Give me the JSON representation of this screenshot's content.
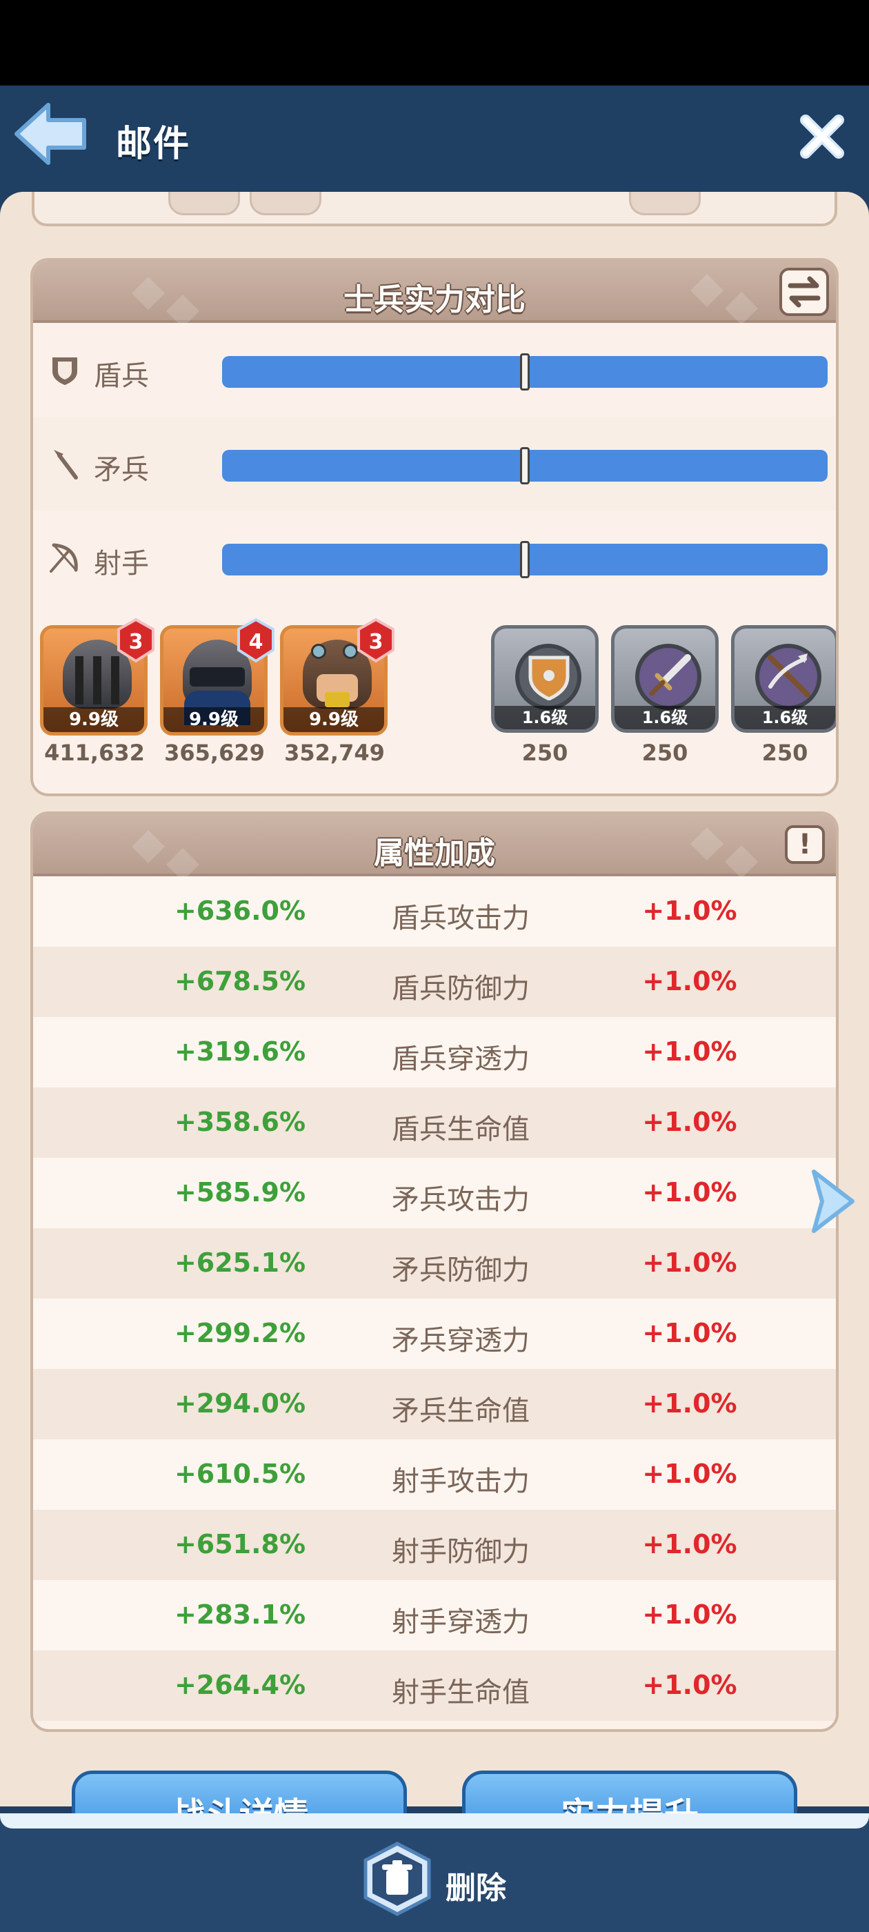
{
  "header": {
    "title": "邮件"
  },
  "comparison": {
    "title": "士兵实力对比",
    "rows": [
      {
        "label": "盾兵",
        "icon": "shield-icon",
        "ratio": 0.5
      },
      {
        "label": "矛兵",
        "icon": "spear-icon",
        "ratio": 0.5
      },
      {
        "label": "射手",
        "icon": "bow-icon",
        "ratio": 0.5
      }
    ],
    "units": [
      {
        "level": "9.9级",
        "stars": "3",
        "power": "411,632",
        "kind": "shield-soldier"
      },
      {
        "level": "9.9级",
        "stars": "4",
        "power": "365,629",
        "kind": "spear-soldier"
      },
      {
        "level": "9.9级",
        "stars": "3",
        "power": "352,749",
        "kind": "archer-soldier"
      }
    ],
    "gear": [
      {
        "level": "1.6级",
        "value": "250",
        "icon": "shield-gear-icon"
      },
      {
        "level": "1.6级",
        "value": "250",
        "icon": "spear-gear-icon"
      },
      {
        "level": "1.6级",
        "value": "250",
        "icon": "bow-gear-icon"
      }
    ]
  },
  "attributes": {
    "title": "属性加成",
    "rows": [
      {
        "left": "+636.0%",
        "name": "盾兵攻击力",
        "right": "+1.0%"
      },
      {
        "left": "+678.5%",
        "name": "盾兵防御力",
        "right": "+1.0%"
      },
      {
        "left": "+319.6%",
        "name": "盾兵穿透力",
        "right": "+1.0%"
      },
      {
        "left": "+358.6%",
        "name": "盾兵生命值",
        "right": "+1.0%"
      },
      {
        "left": "+585.9%",
        "name": "矛兵攻击力",
        "right": "+1.0%"
      },
      {
        "left": "+625.1%",
        "name": "矛兵防御力",
        "right": "+1.0%"
      },
      {
        "left": "+299.2%",
        "name": "矛兵穿透力",
        "right": "+1.0%"
      },
      {
        "left": "+294.0%",
        "name": "矛兵生命值",
        "right": "+1.0%"
      },
      {
        "left": "+610.5%",
        "name": "射手攻击力",
        "right": "+1.0%"
      },
      {
        "left": "+651.8%",
        "name": "射手防御力",
        "right": "+1.0%"
      },
      {
        "left": "+283.1%",
        "name": "射手穿透力",
        "right": "+1.0%"
      },
      {
        "left": "+264.4%",
        "name": "射手生命值",
        "right": "+1.0%"
      }
    ]
  },
  "buttons": {
    "battle_details": "战斗详情",
    "power_up": "实力提升",
    "delete": "删除"
  },
  "colors": {
    "bar": "#4a8ae0",
    "positive": "#3ea03a",
    "negative": "#e0272b",
    "topbar": "#1f3f63"
  }
}
